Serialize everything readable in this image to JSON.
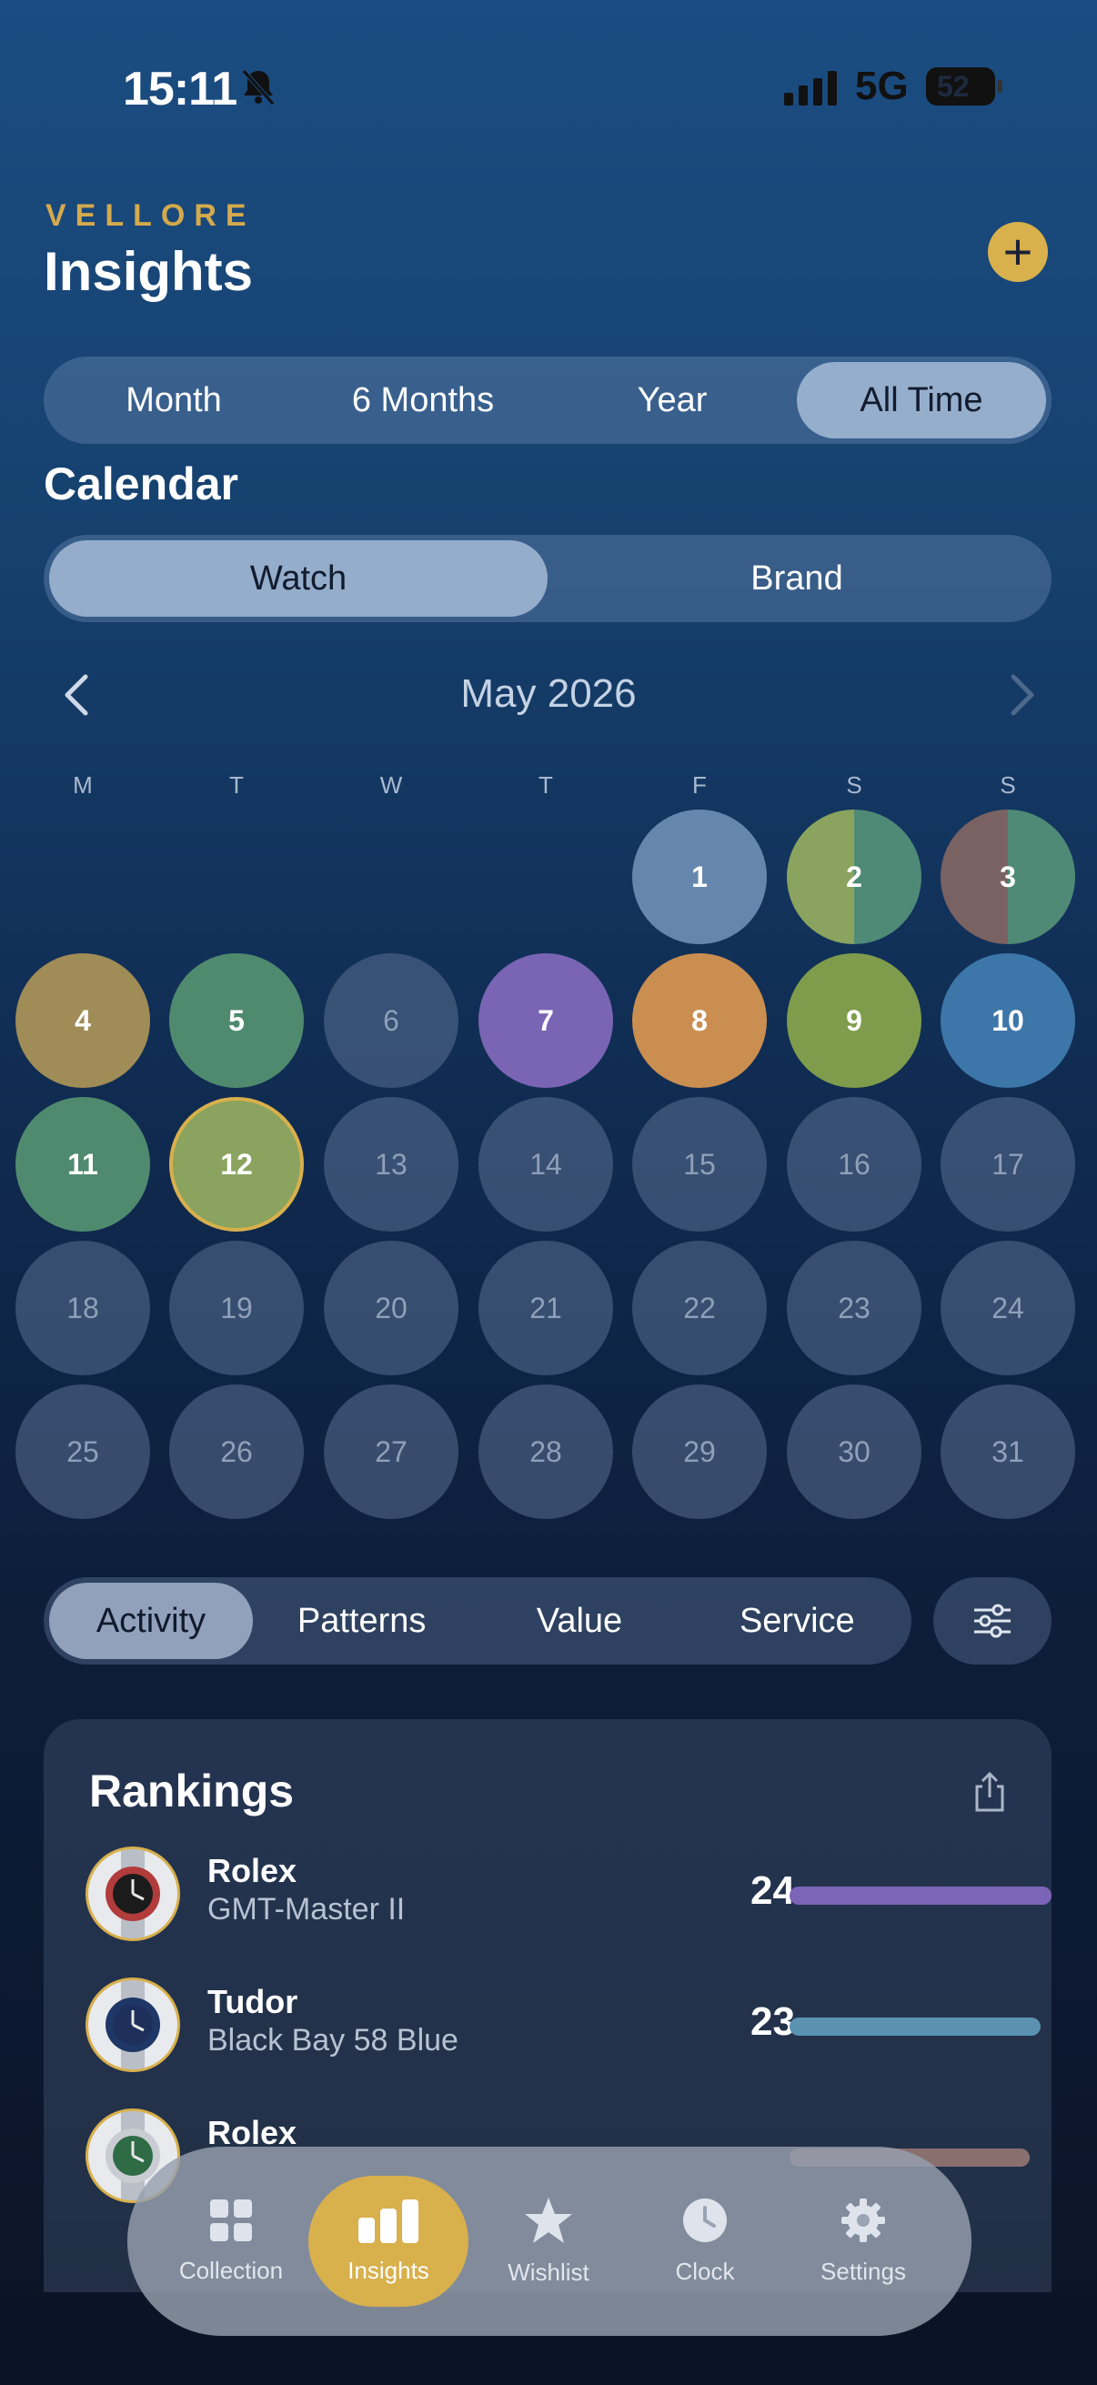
{
  "status": {
    "time": "15:11",
    "network": "5G",
    "battery": "52"
  },
  "header": {
    "brand": "VELLORE",
    "title": "Insights",
    "add_label": "+"
  },
  "range": {
    "options": [
      "Month",
      "6 Months",
      "Year",
      "All Time"
    ],
    "selected": "All Time"
  },
  "calendar": {
    "title": "Calendar",
    "mode_options": [
      "Watch",
      "Brand"
    ],
    "mode_selected": "Watch",
    "month_label": "May 2026",
    "weekdays": [
      "M",
      "T",
      "W",
      "T",
      "F",
      "S",
      "S"
    ],
    "first_weekday_index": 4,
    "today": 12,
    "days": [
      {
        "n": "1",
        "colors": [
          "#6687ad"
        ]
      },
      {
        "n": "2",
        "colors": [
          "#8aa35e",
          "#4f8a77"
        ]
      },
      {
        "n": "3",
        "colors": [
          "#7a6262",
          "#4f8a77"
        ]
      },
      {
        "n": "4",
        "colors": [
          "#a08c56"
        ]
      },
      {
        "n": "5",
        "colors": [
          "#4f8a6f"
        ]
      },
      {
        "n": "6",
        "colors": []
      },
      {
        "n": "7",
        "colors": [
          "#7a64b4"
        ]
      },
      {
        "n": "8",
        "colors": [
          "#c98e50"
        ]
      },
      {
        "n": "9",
        "colors": [
          "#7e9c4c"
        ]
      },
      {
        "n": "10",
        "colors": [
          "#3d76a8"
        ]
      },
      {
        "n": "11",
        "colors": [
          "#4f8a6f"
        ]
      },
      {
        "n": "12",
        "colors": [
          "#8aa35e"
        ]
      },
      {
        "n": "13",
        "colors": []
      },
      {
        "n": "14",
        "colors": []
      },
      {
        "n": "15",
        "colors": []
      },
      {
        "n": "16",
        "colors": []
      },
      {
        "n": "17",
        "colors": []
      },
      {
        "n": "18",
        "colors": []
      },
      {
        "n": "19",
        "colors": []
      },
      {
        "n": "20",
        "colors": []
      },
      {
        "n": "21",
        "colors": []
      },
      {
        "n": "22",
        "colors": []
      },
      {
        "n": "23",
        "colors": []
      },
      {
        "n": "24",
        "colors": []
      },
      {
        "n": "25",
        "colors": []
      },
      {
        "n": "26",
        "colors": []
      },
      {
        "n": "27",
        "colors": []
      },
      {
        "n": "28",
        "colors": []
      },
      {
        "n": "29",
        "colors": []
      },
      {
        "n": "30",
        "colors": []
      },
      {
        "n": "31",
        "colors": []
      }
    ]
  },
  "insight_tabs": {
    "options": [
      "Activity",
      "Patterns",
      "Value",
      "Service"
    ],
    "selected": "Activity"
  },
  "rankings": {
    "title": "Rankings",
    "max_count": 24,
    "items": [
      {
        "brand": "Rolex",
        "model": "GMT-Master II",
        "count": "24",
        "count_value": 24,
        "bar_color": "#7c64b8",
        "dial": "#1b1b1b",
        "bezel": "#b23b3b"
      },
      {
        "brand": "Tudor",
        "model": "Black Bay 58 Blue",
        "count": "23",
        "count_value": 23,
        "bar_color": "#5a92b0",
        "dial": "#1d2f5a",
        "bezel": "#1e3766"
      },
      {
        "brand": "Rolex",
        "model": "",
        "count": "",
        "count_value": 22,
        "bar_color": "#8a6f6f",
        "dial": "#2f6b45",
        "bezel": "#c9ccd2"
      }
    ]
  },
  "tabbar": {
    "items": [
      {
        "label": "Collection",
        "icon": "grid-icon"
      },
      {
        "label": "Insights",
        "icon": "chart-icon"
      },
      {
        "label": "Wishlist",
        "icon": "star-icon"
      },
      {
        "label": "Clock",
        "icon": "clock-icon"
      },
      {
        "label": "Settings",
        "icon": "gear-icon"
      }
    ],
    "active": "Insights"
  },
  "colors": {
    "accent": "#d8b04c"
  }
}
